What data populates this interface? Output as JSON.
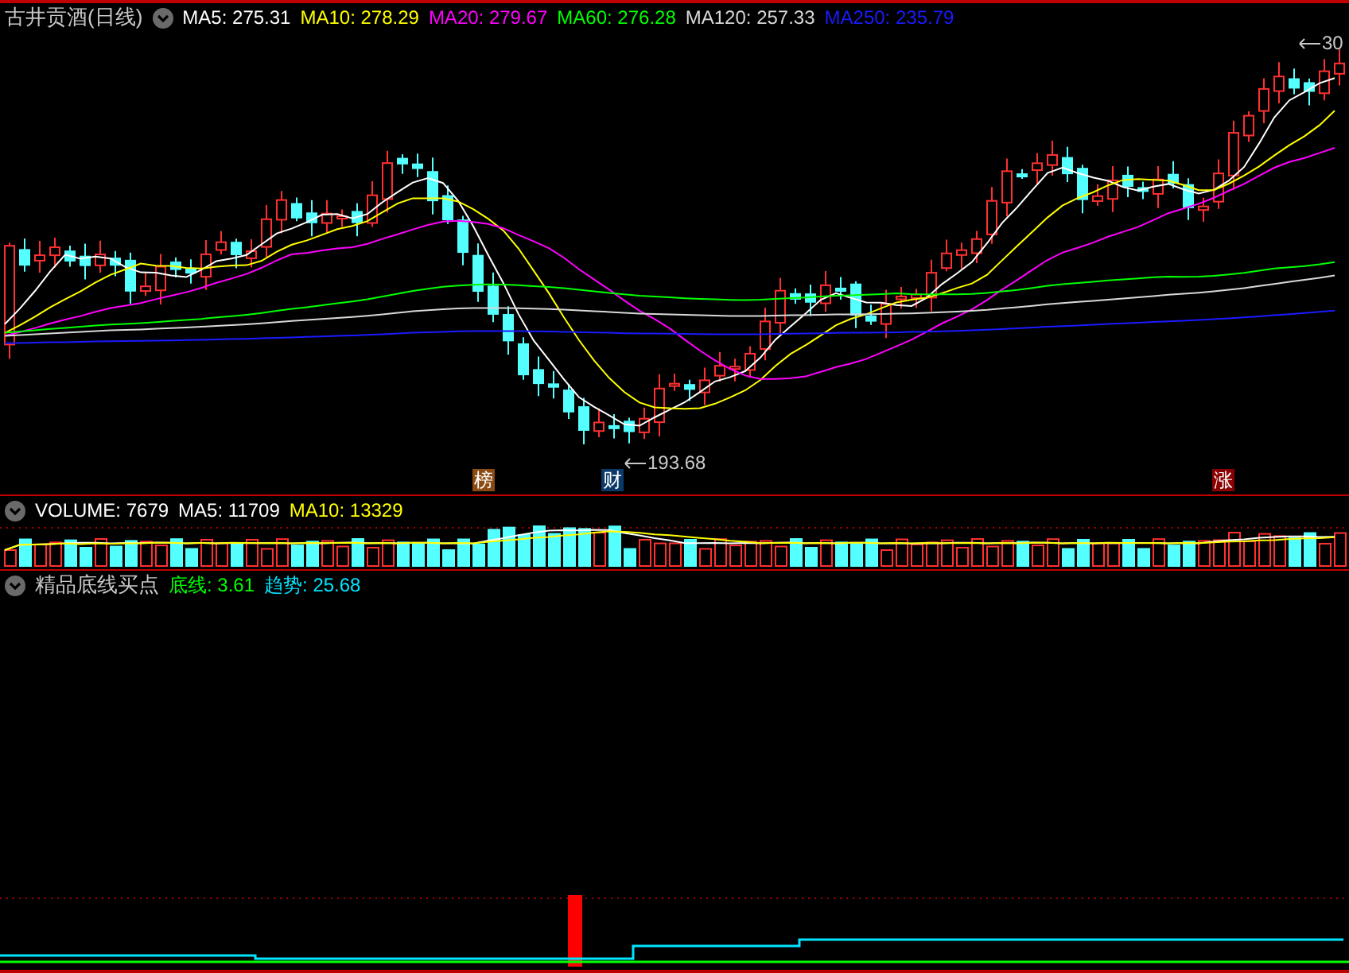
{
  "header": {
    "title": "古井贡酒(日线)",
    "indicators": [
      {
        "label": "MA5: 275.31",
        "color": "#ffffff"
      },
      {
        "label": "MA10: 278.29",
        "color": "#ffff00"
      },
      {
        "label": "MA20: 279.67",
        "color": "#ff00ff"
      },
      {
        "label": "MA60: 276.28",
        "color": "#00ff00"
      },
      {
        "label": "MA120: 257.33",
        "color": "#d8d8d8"
      },
      {
        "label": "MA250: 235.79",
        "color": "#1a1aff"
      }
    ]
  },
  "price_marks": [
    {
      "label": "193.68"
    },
    {
      "label": "30"
    }
  ],
  "event_tags": [
    {
      "label": "榜",
      "color": "#8b4a12"
    },
    {
      "label": "财",
      "color": "#0b3a6a"
    },
    {
      "label": "涨",
      "color": "#8a0000"
    }
  ],
  "volume": {
    "indicators": [
      {
        "label": "VOLUME: 7679",
        "color": "#ffffff"
      },
      {
        "label": "MA5: 11709",
        "color": "#ffffff"
      },
      {
        "label": "MA10: 13329",
        "color": "#ffff00"
      }
    ]
  },
  "signal": {
    "title": "精品底线买点",
    "indicators": [
      {
        "label": "底线: 3.61",
        "color": "#00ff00"
      },
      {
        "label": "趋势: 25.68",
        "color": "#00e5ff"
      }
    ]
  }
}
